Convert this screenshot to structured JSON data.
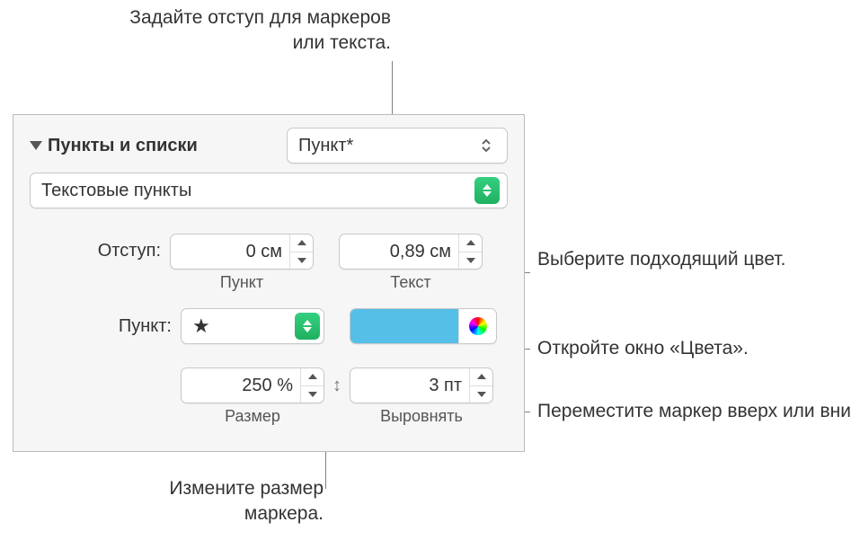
{
  "callouts": {
    "top": "Задайте отступ для маркеров или текста.",
    "color": "Выберите подходящий цвет.",
    "colors_window": "Откройте окно «Цвета».",
    "align": "Переместите маркер вверх или вниз.",
    "size": "Измените размер маркера."
  },
  "panel": {
    "section_label": "Пункты и списки",
    "style_select": "Пункт*",
    "type_select": "Текстовые пункты",
    "indent_label": "Отступ:",
    "indent": {
      "bullet": {
        "value": "0 см",
        "caption": "Пункт"
      },
      "text": {
        "value": "0,89 см",
        "caption": "Текст"
      }
    },
    "bullet_label": "Пункт:",
    "bullet_symbol": "★",
    "size": {
      "value": "250 %",
      "caption": "Размер"
    },
    "align": {
      "value": "3 пт",
      "caption": "Выровнять"
    }
  }
}
